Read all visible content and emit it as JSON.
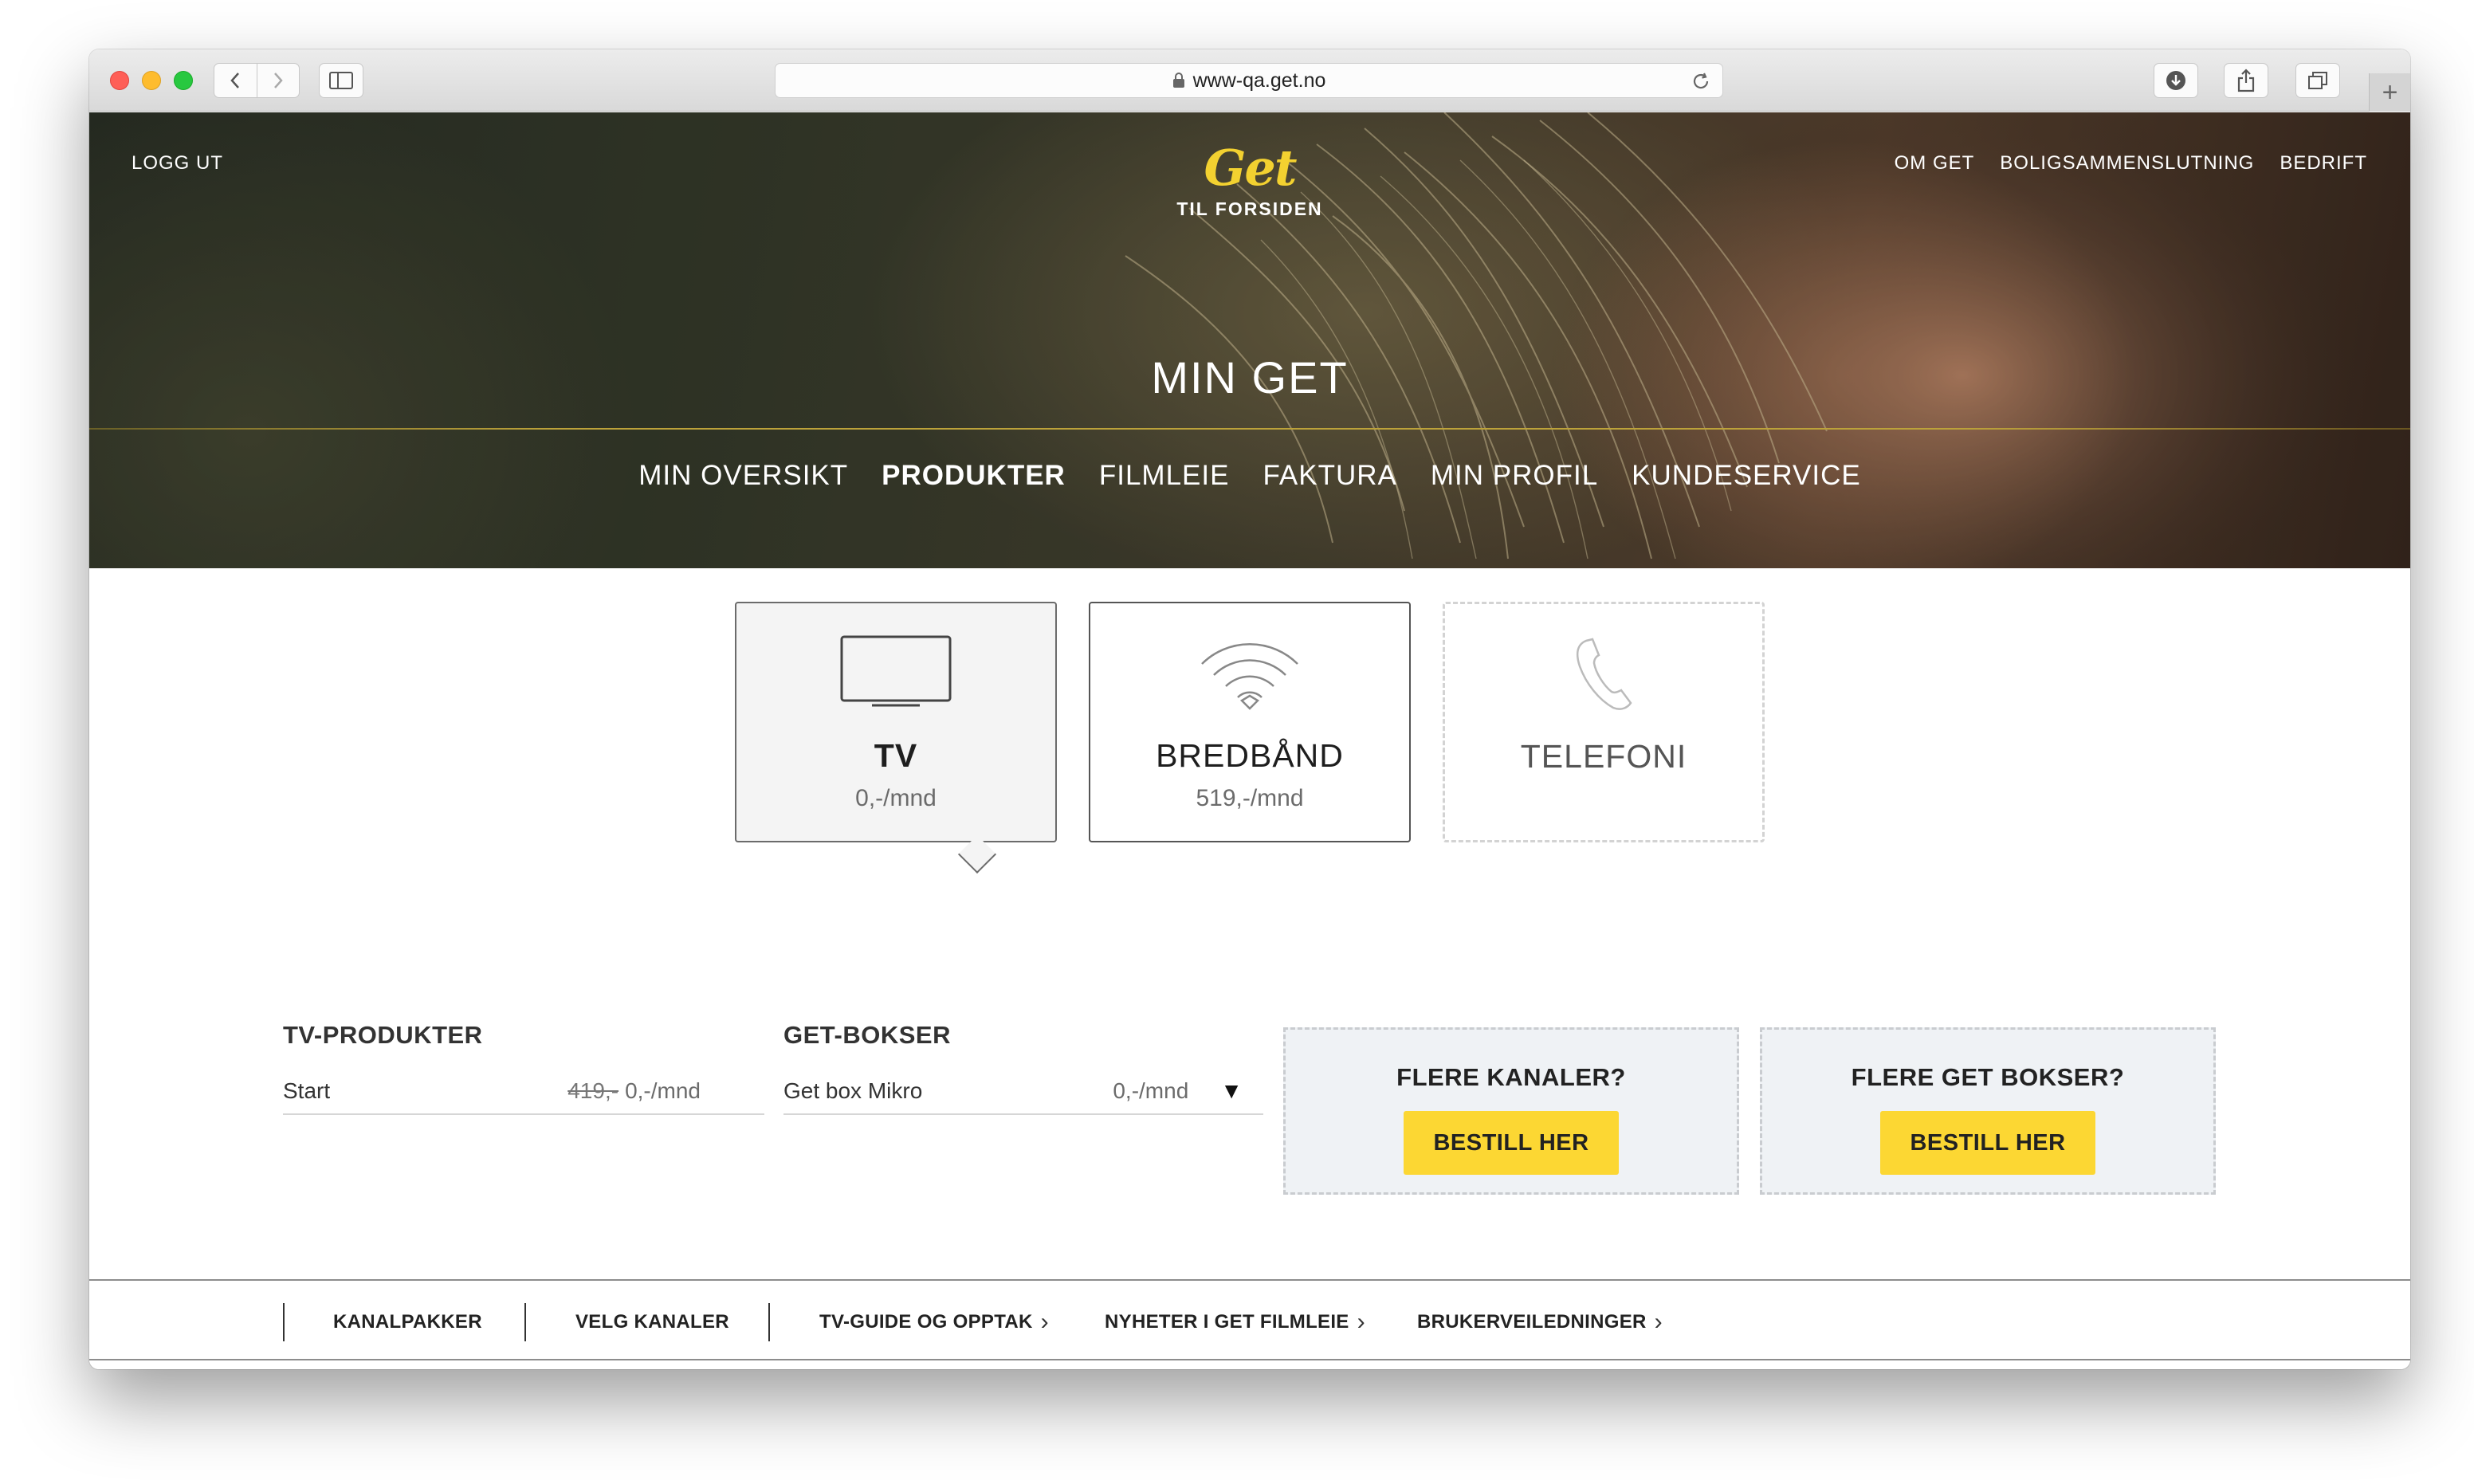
{
  "browser": {
    "url": "www-qa.get.no",
    "new_tab_symbol": "+"
  },
  "header": {
    "logout": "LOGG UT",
    "logo_text": "Get",
    "logo_subtitle": "TIL FORSIDEN",
    "top_links": [
      "OM GET",
      "BOLIGSAMMENSLUTNING",
      "BEDRIFT"
    ],
    "title": "MIN GET",
    "nav": [
      {
        "label": "MIN OVERSIKT"
      },
      {
        "label": "PRODUKTER"
      },
      {
        "label": "FILMLEIE"
      },
      {
        "label": "FAKTURA"
      },
      {
        "label": "MIN PROFIL"
      },
      {
        "label": "KUNDESERVICE"
      }
    ],
    "active_nav": "PRODUKTER"
  },
  "products": [
    {
      "label": "TV",
      "price": "0,-/mnd",
      "icon": "tv-icon",
      "state": "selected"
    },
    {
      "label": "BREDBÅND",
      "price": "519,-/mnd",
      "icon": "wifi-icon",
      "state": "normal"
    },
    {
      "label": "TELEFONI",
      "price": "",
      "icon": "phone-icon",
      "state": "disabled"
    }
  ],
  "tv_products": {
    "title": "TV-PRODUKTER",
    "name": "Start",
    "old_price": "419,-",
    "price": "0,-/mnd"
  },
  "get_boxes": {
    "title": "GET-BOKSER",
    "name": "Get box Mikro",
    "price": "0,-/mnd",
    "caret": "▼"
  },
  "promos": [
    {
      "title": "FLERE KANALER?",
      "button": "BESTILL HER"
    },
    {
      "title": "FLERE GET BOKSER?",
      "button": "BESTILL HER"
    }
  ],
  "subnav": [
    {
      "label": "KANALPAKKER"
    },
    {
      "label": "VELG KANALER"
    },
    {
      "label": "TV-GUIDE OG OPPTAK",
      "chevron": "›"
    },
    {
      "label": "NYHETER I GET FILMLEIE",
      "chevron": "›"
    },
    {
      "label": "BRUKERVEILEDNINGER",
      "chevron": "›"
    }
  ],
  "colors": {
    "accent_yellow": "#fcd733",
    "logo_yellow": "#f3d130",
    "promo_bg": "#eff2f5"
  }
}
